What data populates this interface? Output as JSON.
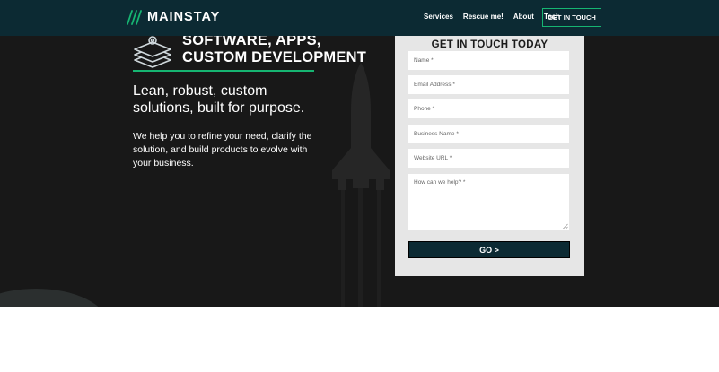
{
  "brand": {
    "name": "MAINSTAY",
    "accent": "#16b572",
    "nav_bg": "#0c2a33",
    "icon": "slash-logo-icon"
  },
  "nav": {
    "links": [
      {
        "label": "Services"
      },
      {
        "label": "Rescue me!"
      },
      {
        "label": "About"
      },
      {
        "label": "Tech"
      }
    ],
    "cta_label": "GET IN TOUCH"
  },
  "hero": {
    "icon": "layers-gear-icon",
    "title_line1": "SOFTWARE, APPS,",
    "title_line2": "CUSTOM DEVELOPMENT",
    "headline_line1": "Lean, robust, custom",
    "headline_line2": "solutions, built for purpose.",
    "body_line1": "We help you to refine your need, clarify the",
    "body_line2": "solution, and build products to evolve with",
    "body_line3": "your business.",
    "background_icon": "rocket-icon"
  },
  "form": {
    "title": "GET IN TOUCH TODAY",
    "fields": [
      {
        "placeholder": "Name *"
      },
      {
        "placeholder": "Email Address *"
      },
      {
        "placeholder": "Phone *"
      },
      {
        "placeholder": "Business Name *"
      },
      {
        "placeholder": "Website URL *"
      }
    ],
    "message_placeholder": "How can we help? *",
    "submit_label": "GO >"
  }
}
